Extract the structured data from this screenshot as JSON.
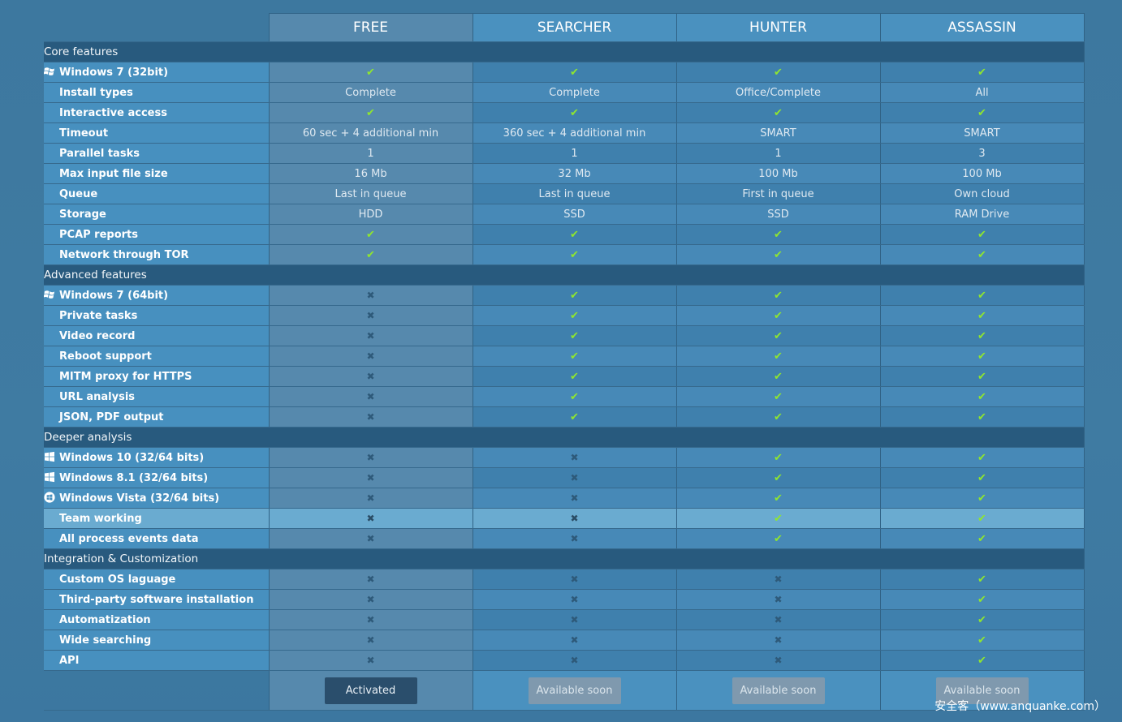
{
  "plans": [
    "FREE",
    "SEARCHER",
    "HUNTER",
    "ASSASSIN"
  ],
  "sections": [
    {
      "title": "Core features",
      "rows": [
        {
          "label": "Windows 7 (32bit)",
          "icon": "windows-7-icon",
          "values": [
            "check",
            "check",
            "check",
            "check"
          ]
        },
        {
          "label": "Install types",
          "icon": "",
          "values": [
            "Complete",
            "Complete",
            "Office/Complete",
            "All"
          ]
        },
        {
          "label": "Interactive access",
          "icon": "",
          "values": [
            "check",
            "check",
            "check",
            "check"
          ]
        },
        {
          "label": "Timeout",
          "icon": "",
          "values": [
            "60 sec + 4 additional min",
            "360 sec + 4 additional min",
            "SMART",
            "SMART"
          ]
        },
        {
          "label": "Parallel tasks",
          "icon": "",
          "values": [
            "1",
            "1",
            "1",
            "3"
          ]
        },
        {
          "label": "Max input file size",
          "icon": "",
          "values": [
            "16 Mb",
            "32 Mb",
            "100 Mb",
            "100 Mb"
          ]
        },
        {
          "label": "Queue",
          "icon": "",
          "values": [
            "Last in queue",
            "Last in queue",
            "First in queue",
            "Own cloud"
          ]
        },
        {
          "label": "Storage",
          "icon": "",
          "values": [
            "HDD",
            "SSD",
            "SSD",
            "RAM Drive"
          ]
        },
        {
          "label": "PCAP reports",
          "icon": "",
          "values": [
            "check",
            "check",
            "check",
            "check"
          ]
        },
        {
          "label": "Network through TOR",
          "icon": "",
          "values": [
            "check",
            "check",
            "check",
            "check"
          ]
        }
      ]
    },
    {
      "title": "Advanced features",
      "rows": [
        {
          "label": "Windows 7 (64bit)",
          "icon": "windows-7-icon",
          "values": [
            "cross",
            "check",
            "check",
            "check"
          ]
        },
        {
          "label": "Private tasks",
          "icon": "",
          "values": [
            "cross",
            "check",
            "check",
            "check"
          ]
        },
        {
          "label": "Video record",
          "icon": "",
          "values": [
            "cross",
            "check",
            "check",
            "check"
          ]
        },
        {
          "label": "Reboot support",
          "icon": "",
          "values": [
            "cross",
            "check",
            "check",
            "check"
          ]
        },
        {
          "label": "MITM proxy for HTTPS",
          "icon": "",
          "values": [
            "cross",
            "check",
            "check",
            "check"
          ]
        },
        {
          "label": "URL analysis",
          "icon": "",
          "values": [
            "cross",
            "check",
            "check",
            "check"
          ]
        },
        {
          "label": "JSON, PDF output",
          "icon": "",
          "values": [
            "cross",
            "check",
            "check",
            "check"
          ]
        }
      ]
    },
    {
      "title": "Deeper analysis",
      "rows": [
        {
          "label": "Windows 10 (32/64 bits)",
          "icon": "windows-10-icon",
          "values": [
            "cross",
            "cross",
            "check",
            "check"
          ]
        },
        {
          "label": "Windows 8.1 (32/64 bits)",
          "icon": "windows-8-icon",
          "values": [
            "cross",
            "cross",
            "check",
            "check"
          ]
        },
        {
          "label": "Windows Vista (32/64 bits)",
          "icon": "windows-vista-icon",
          "values": [
            "cross",
            "cross",
            "check",
            "check"
          ]
        },
        {
          "label": "Team working",
          "icon": "",
          "values": [
            "cross",
            "cross",
            "check",
            "check"
          ],
          "highlight": true
        },
        {
          "label": "All process events data",
          "icon": "",
          "values": [
            "cross",
            "cross",
            "check",
            "check"
          ]
        }
      ]
    },
    {
      "title": "Integration & Customization",
      "rows": [
        {
          "label": "Custom OS laguage",
          "icon": "",
          "values": [
            "cross",
            "cross",
            "cross",
            "check"
          ]
        },
        {
          "label": "Third-party software installation",
          "icon": "",
          "values": [
            "cross",
            "cross",
            "cross",
            "check"
          ]
        },
        {
          "label": "Automatization",
          "icon": "",
          "values": [
            "cross",
            "cross",
            "cross",
            "check"
          ]
        },
        {
          "label": "Wide searching",
          "icon": "",
          "values": [
            "cross",
            "cross",
            "cross",
            "check"
          ]
        },
        {
          "label": "API",
          "icon": "",
          "values": [
            "cross",
            "cross",
            "cross",
            "check"
          ]
        }
      ]
    }
  ],
  "buttons": [
    "Activated",
    "Available soon",
    "Available soon",
    "Available soon"
  ],
  "watermark": "安全客（www.anquanke.com）",
  "colors": {
    "check": "#8fe62f",
    "cross": "#2e5a7a",
    "category": "#285a7e",
    "activated": "#2a4e6c",
    "soon": "#7f99ae"
  }
}
